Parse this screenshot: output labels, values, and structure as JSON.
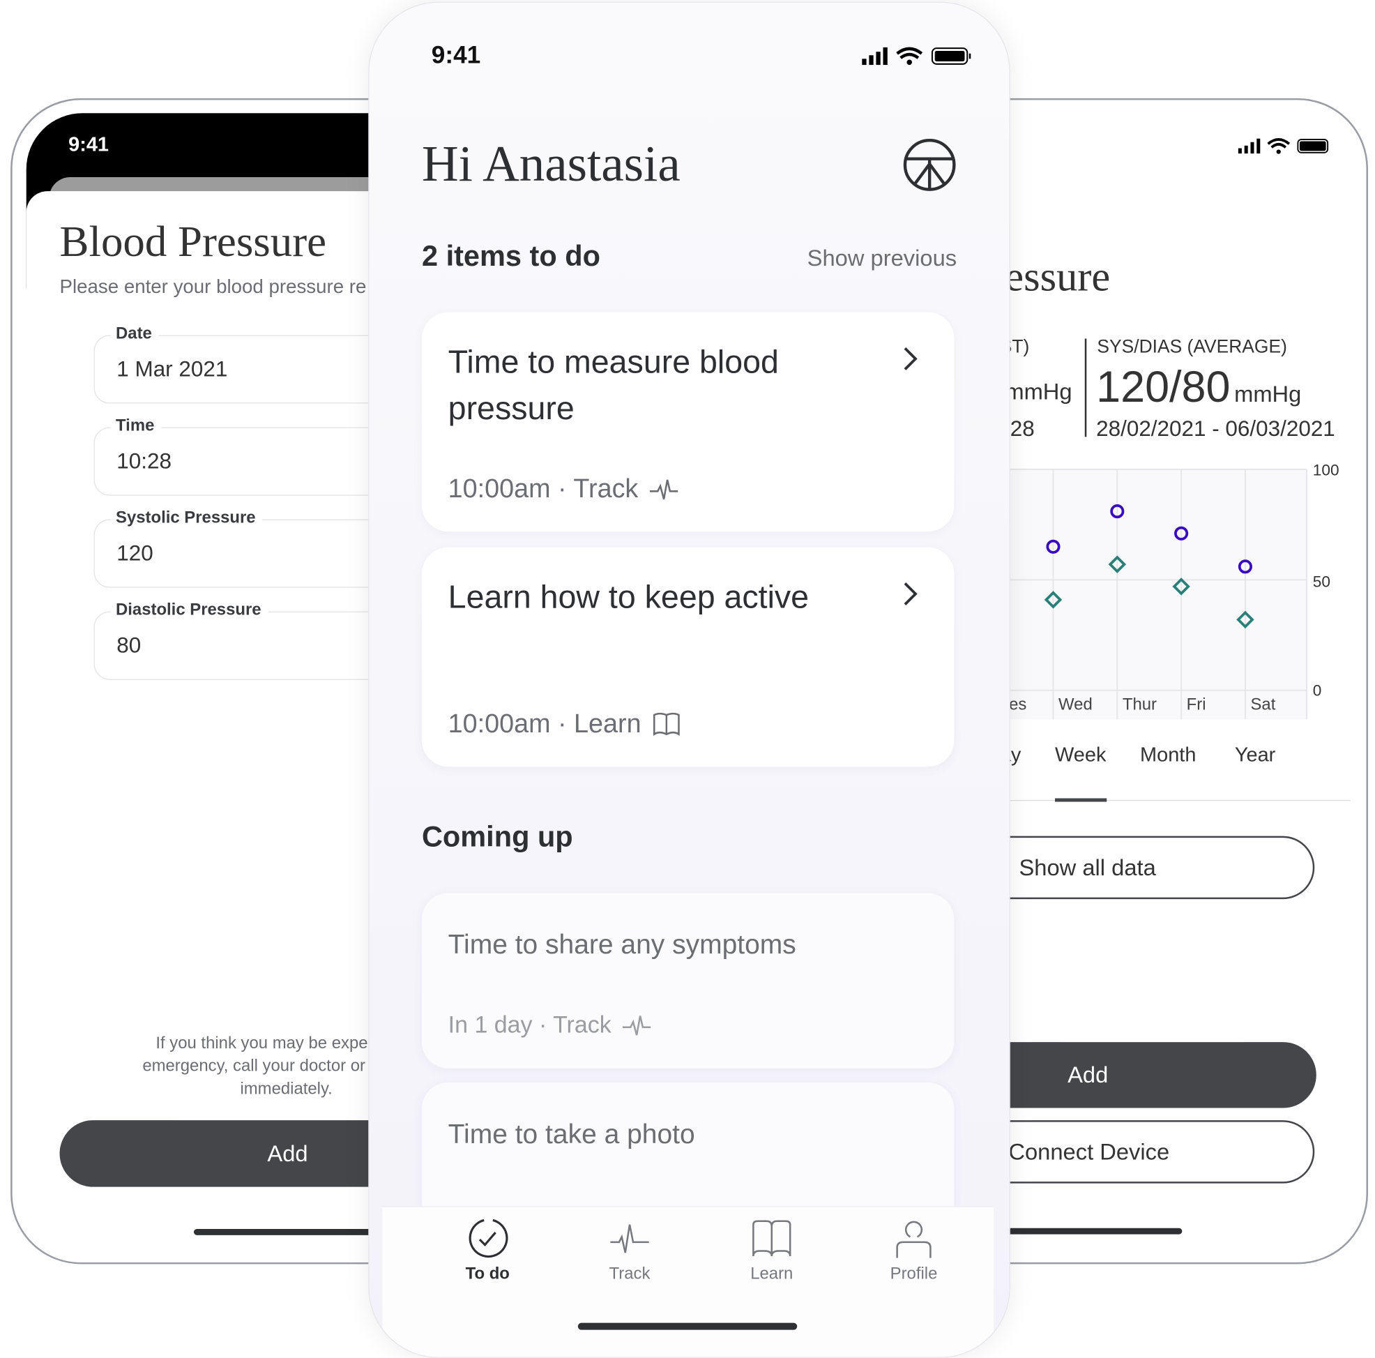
{
  "left_screen": {
    "status_time": "9:41",
    "title": "Blood Pressure",
    "subtitle": "Please enter your blood pressure re",
    "fields": [
      {
        "label": "Date",
        "value": "1 Mar 2021"
      },
      {
        "label": "Time",
        "value": "10:28"
      },
      {
        "label": "Systolic Pressure",
        "value": "120"
      },
      {
        "label": "Diastolic Pressure",
        "value": "80"
      }
    ],
    "disclaimer_lines": [
      "If you think you may be experiencin",
      "emergency, call your doctor or the eme",
      "immediately."
    ],
    "add_label": "Add"
  },
  "center_screen": {
    "status_time": "9:41",
    "greeting": "Hi Anastasia",
    "todo_heading": "2 items to do",
    "show_previous": "Show previous",
    "todo_cards": [
      {
        "title": "Time to measure blood pressure",
        "meta": "10:00am · Track",
        "icon": "pulse-icon"
      },
      {
        "title": "Learn how to keep active",
        "meta": "10:00am · Learn",
        "icon": "book-icon"
      }
    ],
    "coming_up_heading": "Coming up",
    "upcoming_cards": [
      {
        "title": "Time to share any symptoms",
        "meta": "In 1 day · Track",
        "icon": "pulse-icon"
      },
      {
        "title": "Time to take a photo"
      }
    ],
    "tabs": [
      {
        "label": "To do",
        "icon": "check-circle-icon",
        "active": true
      },
      {
        "label": "Track",
        "icon": "pulse-icon",
        "active": false
      },
      {
        "label": "Learn",
        "icon": "book-icon",
        "active": false
      },
      {
        "label": "Profile",
        "icon": "person-icon",
        "active": false
      }
    ]
  },
  "right_screen": {
    "title": "ressure",
    "latest_label": "ST)",
    "latest_unit": "mmHg",
    "latest_time": ":28",
    "avg_label": "SYS/DIAS (AVERAGE)",
    "avg_value": "120/80",
    "avg_unit": "mmHg",
    "avg_range": "28/02/2021 - 06/03/2021",
    "period_tabs": [
      {
        "label": "ay",
        "active": false
      },
      {
        "label": "Week",
        "active": true
      },
      {
        "label": "Month",
        "active": false
      },
      {
        "label": "Year",
        "active": false
      }
    ],
    "show_all_label": "Show all data",
    "add_label": "Add",
    "connect_label": "Connect Device"
  },
  "chart_data": {
    "type": "scatter",
    "categories": [
      "ues",
      "Wed",
      "Thur",
      "Fri",
      "Sat"
    ],
    "ylim": [
      0,
      100
    ],
    "yticks": [
      "100",
      "50",
      "0"
    ],
    "grid": true,
    "series": [
      {
        "marker": "circle",
        "color": "#3a0cc0",
        "values": [
          null,
          65,
          81,
          71,
          56
        ]
      },
      {
        "marker": "diamond",
        "color": "#2a7f78",
        "values": [
          null,
          41,
          57,
          47,
          32
        ]
      }
    ]
  },
  "colors": {
    "dark_button": "#45464a",
    "systolic": "#3a0cc0",
    "diastolic": "#2a7f78"
  }
}
